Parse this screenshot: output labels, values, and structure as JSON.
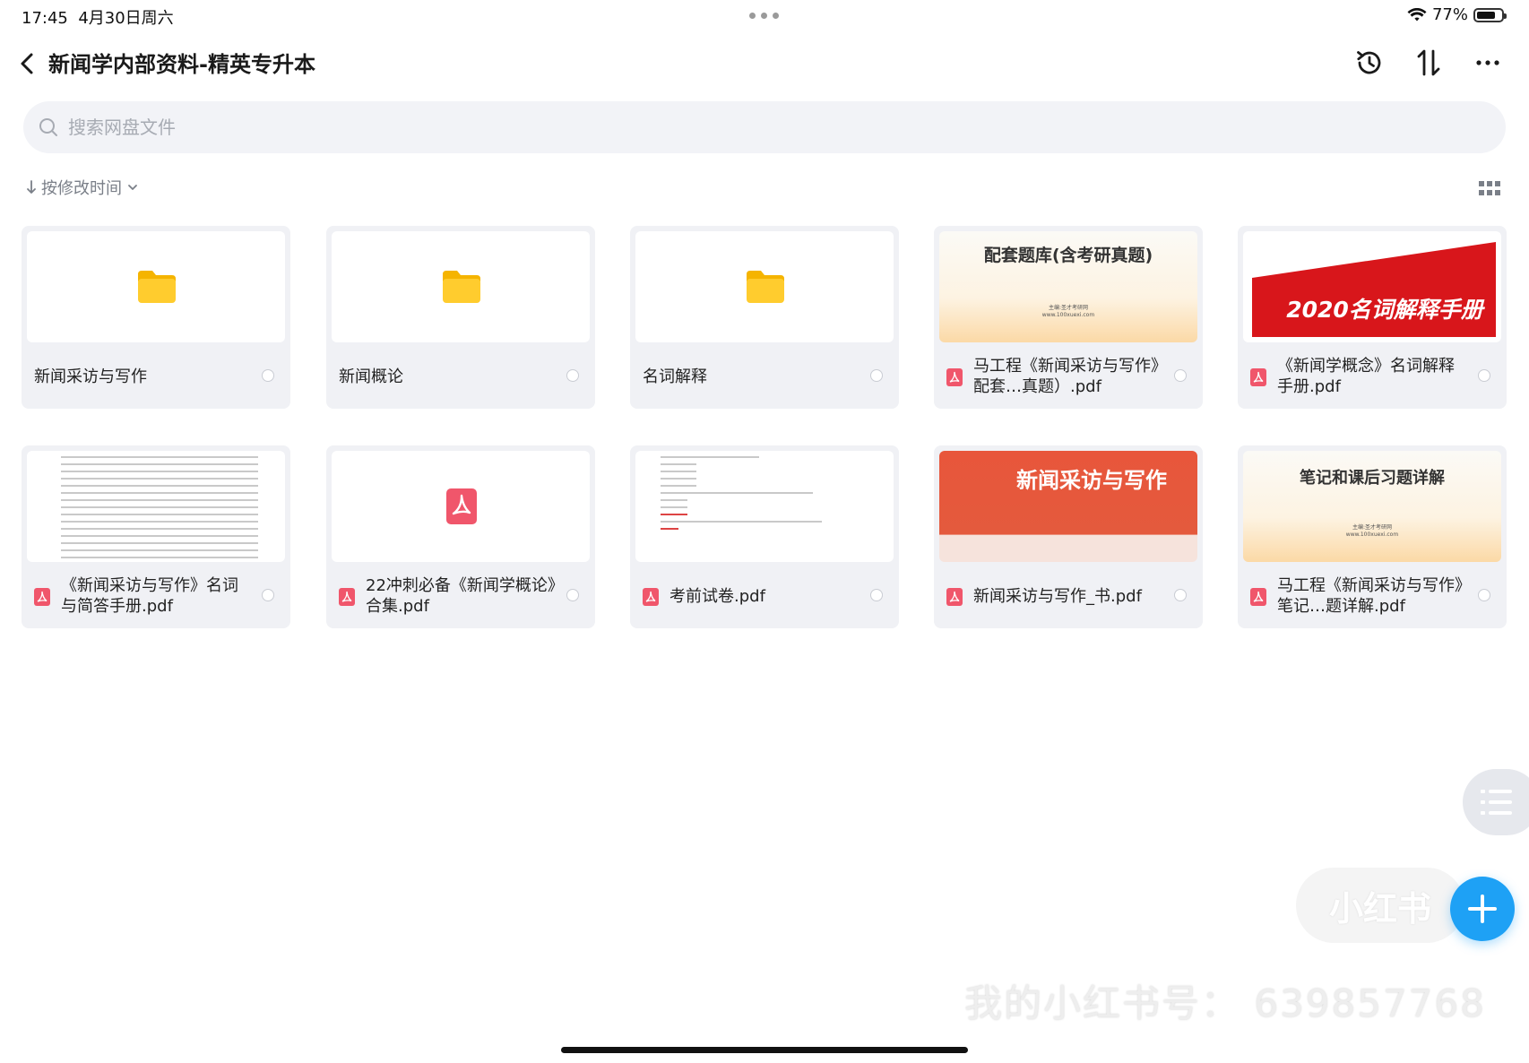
{
  "status_bar": {
    "time": "17:45",
    "date": "4月30日周六",
    "battery": "77%",
    "battery_level": 0.77
  },
  "nav": {
    "title": "新闻学内部资料-精英专升本"
  },
  "search": {
    "placeholder": "搜索网盘文件"
  },
  "sort": {
    "label": "按修改时间"
  },
  "files": [
    {
      "name": "新闻采访与写作",
      "type": "folder"
    },
    {
      "name": "新闻概论",
      "type": "folder"
    },
    {
      "name": "名词解释",
      "type": "folder"
    },
    {
      "name": "马工程《新闻采访与写作》配套…真题）.pdf",
      "type": "pdf",
      "thumb": {
        "title": "配套题库(含考研真题)",
        "sub": "主编:圣才考研网",
        "sub2": "www.100xuexi.com"
      }
    },
    {
      "name": "《新闻学概念》名词解释手册.pdf",
      "type": "pdf",
      "thumb": {
        "title": "2020名词解释手册"
      }
    },
    {
      "name": "《新闻采访与写作》名词与简答手册.pdf",
      "type": "pdf"
    },
    {
      "name": "22冲刺必备《新闻学概论》合集.pdf",
      "type": "pdf"
    },
    {
      "name": "考前试卷.pdf",
      "type": "pdf"
    },
    {
      "name": "新闻采访与写作_书.pdf",
      "type": "pdf",
      "thumb": {
        "title": "新闻采访与写作"
      }
    },
    {
      "name": "马工程《新闻采访与写作》笔记…题详解.pdf",
      "type": "pdf",
      "thumb": {
        "title": "笔记和课后习题详解",
        "sub": "主编:圣才考研网",
        "sub2": "www.100xuexi.com"
      }
    }
  ],
  "watermark": {
    "app": "小红书",
    "text": "我的小红书号： 639857768"
  },
  "colors": {
    "accent": "#1ea1f5",
    "folder": "#ffcc2e",
    "pdf": "#f0566b",
    "card_bg": "#f0f1f5",
    "banner_red": "#d8161b"
  },
  "icons": [
    "back-icon",
    "history-icon",
    "sort-icon",
    "more-icon",
    "search-icon",
    "grid-view-icon",
    "folder-icon",
    "pdf-icon",
    "list-icon",
    "plus-icon",
    "wifi-icon",
    "battery-icon"
  ]
}
